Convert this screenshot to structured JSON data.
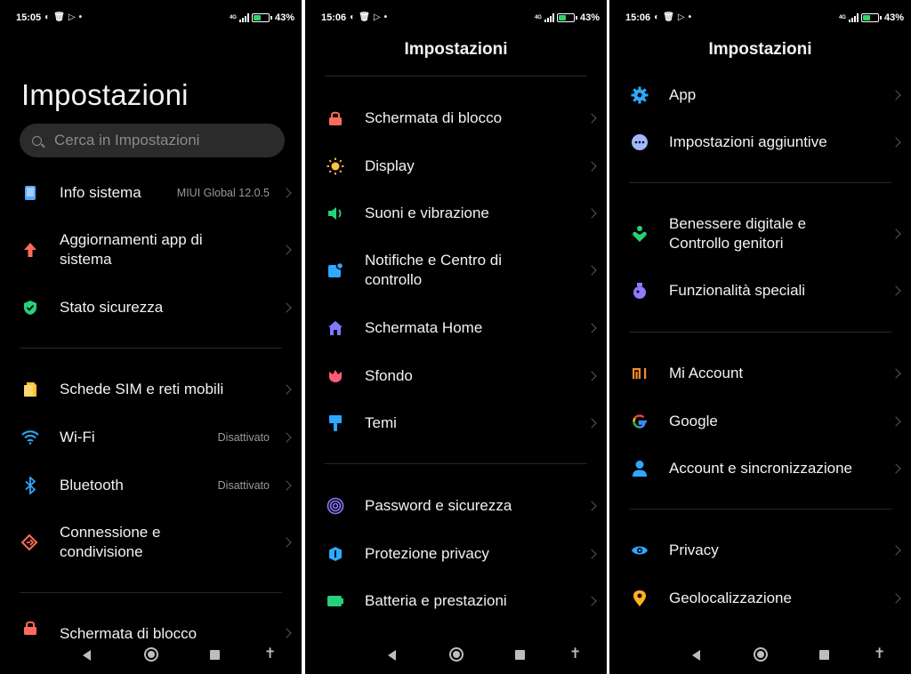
{
  "phones": [
    {
      "status_time": "15:05",
      "network": "4G",
      "battery_pct": "43%",
      "battery_level": 0.43,
      "title": "Impostazioni",
      "search_placeholder": "Cerca in Impostazioni",
      "items": [
        {
          "label": "Info sistema",
          "value": "MIUI Global 12.0.5",
          "icon": "phone-info-icon",
          "color": "#5aa9ff"
        },
        {
          "label": "Aggiornamenti app di sistema",
          "value": "",
          "icon": "arrow-up-icon",
          "color": "#ff6b5a"
        },
        {
          "label": "Stato sicurezza",
          "value": "",
          "icon": "shield-check-icon",
          "color": "#27d07a"
        },
        {
          "label": "Schede SIM e reti mobili",
          "value": "",
          "icon": "sim-card-icon",
          "color": "#ffc23d"
        },
        {
          "label": "Wi-Fi",
          "value": "Disattivato",
          "icon": "wifi-icon",
          "color": "#2fa8ff"
        },
        {
          "label": "Bluetooth",
          "value": "Disattivato",
          "icon": "bluetooth-icon",
          "color": "#2fa8ff"
        },
        {
          "label": "Connessione e condivisione",
          "value": "",
          "icon": "connection-sharing-icon",
          "color": "#ff6b5a"
        },
        {
          "label": "Schermata di blocco",
          "value": "",
          "icon": "lock-icon",
          "color": "#ff6b5a"
        }
      ]
    },
    {
      "status_time": "15:06",
      "network": "4G",
      "battery_pct": "43%",
      "battery_level": 0.43,
      "title": "Impostazioni",
      "items": [
        {
          "label": "Schermata di blocco",
          "icon": "lock-icon",
          "color": "#ff6b5a"
        },
        {
          "label": "Display",
          "icon": "sun-icon",
          "color": "#ffc23d"
        },
        {
          "label": "Suoni e vibrazione",
          "icon": "speaker-icon",
          "color": "#27d07a"
        },
        {
          "label": "Notifiche e Centro di controllo",
          "icon": "notification-icon",
          "color": "#2fa8ff"
        },
        {
          "label": "Schermata Home",
          "icon": "home-icon",
          "color": "#7b7bff"
        },
        {
          "label": "Sfondo",
          "icon": "tulip-icon",
          "color": "#ff5a7a"
        },
        {
          "label": "Temi",
          "icon": "paint-brush-icon",
          "color": "#2fa8ff"
        },
        {
          "label": "Password e sicurezza",
          "icon": "fingerprint-icon",
          "color": "#8a7bff"
        },
        {
          "label": "Protezione privacy",
          "icon": "privacy-protection-icon",
          "color": "#2fa8ff"
        },
        {
          "label": "Batteria e prestazioni",
          "icon": "battery-icon",
          "color": "#27d07a"
        }
      ]
    },
    {
      "status_time": "15:06",
      "network": "4G",
      "battery_pct": "43%",
      "battery_level": 0.43,
      "title": "Impostazioni",
      "items": [
        {
          "label": "App",
          "icon": "gear-icon",
          "color": "#2fa8ff"
        },
        {
          "label": "Impostazioni aggiuntive",
          "icon": "more-dots-icon",
          "color": "#a0b8ff"
        },
        {
          "label": "Benessere digitale e Controllo genitori",
          "icon": "wellbeing-icon",
          "color": "#27d07a"
        },
        {
          "label": "Funzionalità speciali",
          "icon": "potion-icon",
          "color": "#8a7bff"
        },
        {
          "label": "Mi Account",
          "icon": "mi-logo-icon",
          "color": "#ff8a2a"
        },
        {
          "label": "Google",
          "icon": "google-logo-icon",
          "color": "#4285f4"
        },
        {
          "label": "Account e sincronizzazione",
          "icon": "person-icon",
          "color": "#2fa8ff"
        },
        {
          "label": "Privacy",
          "icon": "eye-icon",
          "color": "#2fa8ff"
        },
        {
          "label": "Geolocalizzazione",
          "icon": "location-pin-icon",
          "color": "#ffb020"
        }
      ]
    }
  ]
}
